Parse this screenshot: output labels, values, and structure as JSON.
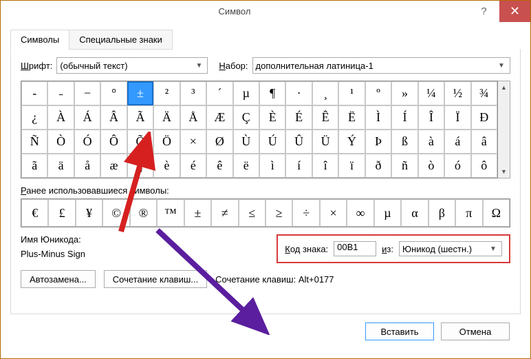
{
  "title": "Символ",
  "tabs": {
    "symbols": "Символы",
    "special": "Специальные знаки"
  },
  "font": {
    "label": "Шрифт:",
    "value": "(обычный текст)"
  },
  "subset": {
    "label": "Набор:",
    "value": "дополнительная латиница-1"
  },
  "grid": [
    [
      "-",
      "˗",
      "−",
      "°",
      "±",
      "²",
      "³",
      "´",
      "µ",
      "¶",
      "·",
      "¸",
      "¹",
      "º",
      "»",
      "¼",
      "½",
      "¾"
    ],
    [
      "¿",
      "À",
      "Á",
      "Â",
      "Ã",
      "Ä",
      "Å",
      "Æ",
      "Ç",
      "È",
      "É",
      "Ê",
      "Ë",
      "Ì",
      "Í",
      "Î",
      "Ï",
      "Ð"
    ],
    [
      "Ñ",
      "Ò",
      "Ó",
      "Ô",
      "Õ",
      "Ö",
      "×",
      "Ø",
      "Ù",
      "Ú",
      "Û",
      "Ü",
      "Ý",
      "Þ",
      "ß",
      "à",
      "á",
      "â"
    ],
    [
      "ã",
      "ä",
      "å",
      "æ",
      "ç",
      "è",
      "é",
      "ê",
      "ë",
      "ì",
      "í",
      "î",
      "ï",
      "ð",
      "ñ",
      "ò",
      "ó",
      "ô"
    ]
  ],
  "recent": {
    "label": "Ранее использовавшиеся символы:",
    "items": [
      "€",
      "£",
      "¥",
      "©",
      "®",
      "™",
      "±",
      "≠",
      "≤",
      "≥",
      "÷",
      "×",
      "∞",
      "µ",
      "α",
      "β",
      "π",
      "Ω"
    ]
  },
  "unicode": {
    "name_label": "Имя Юникода:",
    "name_value": "Plus-Minus Sign"
  },
  "code": {
    "label": "Код знака:",
    "value": "00B1",
    "from_label": "из:",
    "from_value": "Юникод (шестн.)"
  },
  "buttons": {
    "autocorrect": "Автозамена...",
    "shortcut": "Сочетание клавиш...",
    "shortcut_label": "Сочетание клавиш:",
    "shortcut_value": "Alt+0177",
    "insert": "Вставить",
    "cancel": "Отмена"
  }
}
